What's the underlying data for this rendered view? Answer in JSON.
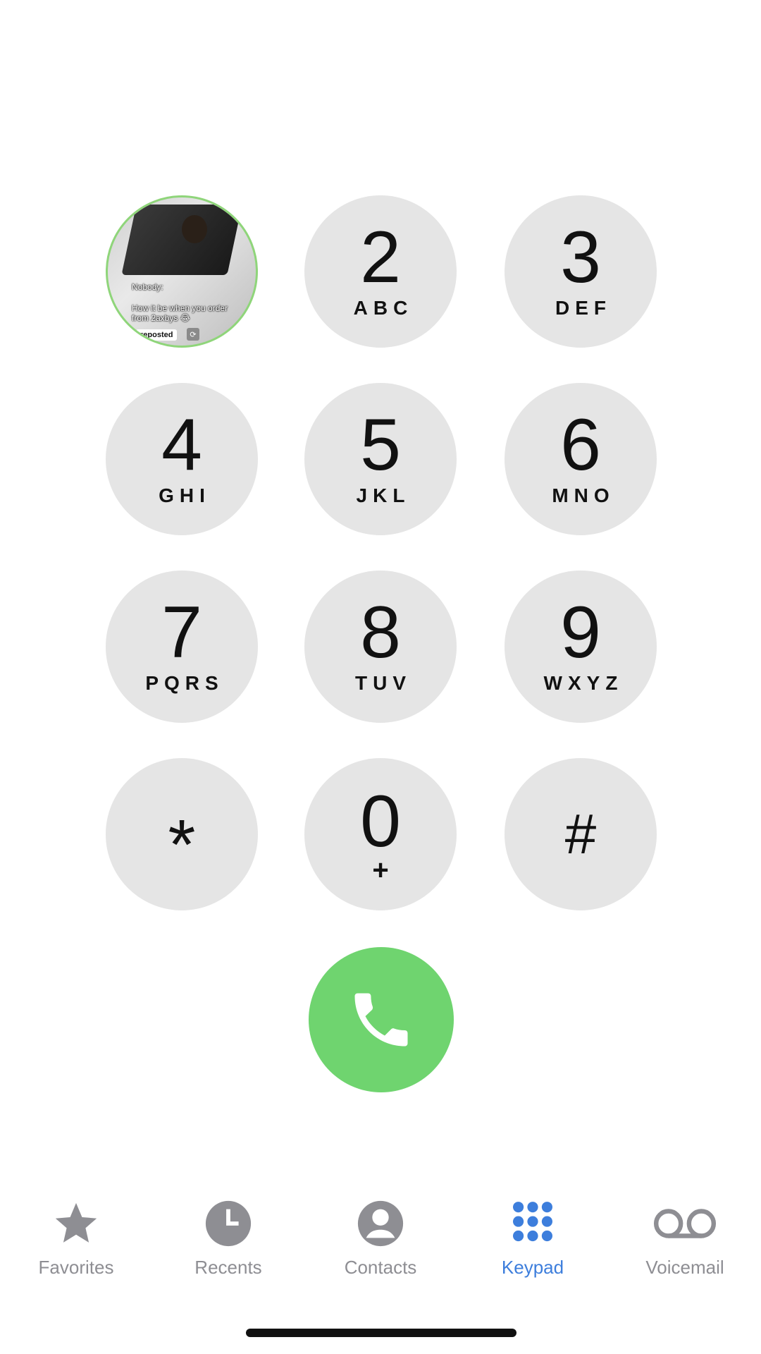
{
  "keypad": {
    "keys": [
      {
        "digit": "2",
        "letters": "ABC"
      },
      {
        "digit": "3",
        "letters": "DEF"
      },
      {
        "digit": "4",
        "letters": "GHI"
      },
      {
        "digit": "5",
        "letters": "JKL"
      },
      {
        "digit": "6",
        "letters": "MNO"
      },
      {
        "digit": "7",
        "letters": "PQRS"
      },
      {
        "digit": "8",
        "letters": "TUV"
      },
      {
        "digit": "9",
        "letters": "WXYZ"
      },
      {
        "digit": "*"
      },
      {
        "digit": "0",
        "letters": "+"
      },
      {
        "digit": "#"
      }
    ]
  },
  "pip_video": {
    "caption_line1": "Nobody:",
    "caption_line2": "How it be when you order from 2axbys 😂",
    "repost_label": "reposted"
  },
  "tabs": [
    {
      "label": "Favorites",
      "icon": "star-icon"
    },
    {
      "label": "Recents",
      "icon": "clock-icon"
    },
    {
      "label": "Contacts",
      "icon": "person-circle-icon"
    },
    {
      "label": "Keypad",
      "icon": "keypad-grid-icon",
      "active": true
    },
    {
      "label": "Voicemail",
      "icon": "voicemail-icon"
    }
  ],
  "colors": {
    "key_background": "#e5e5e5",
    "call_button": "#6fd46f",
    "active_tab": "#3d7edc",
    "inactive_tab": "#8e8e93"
  }
}
